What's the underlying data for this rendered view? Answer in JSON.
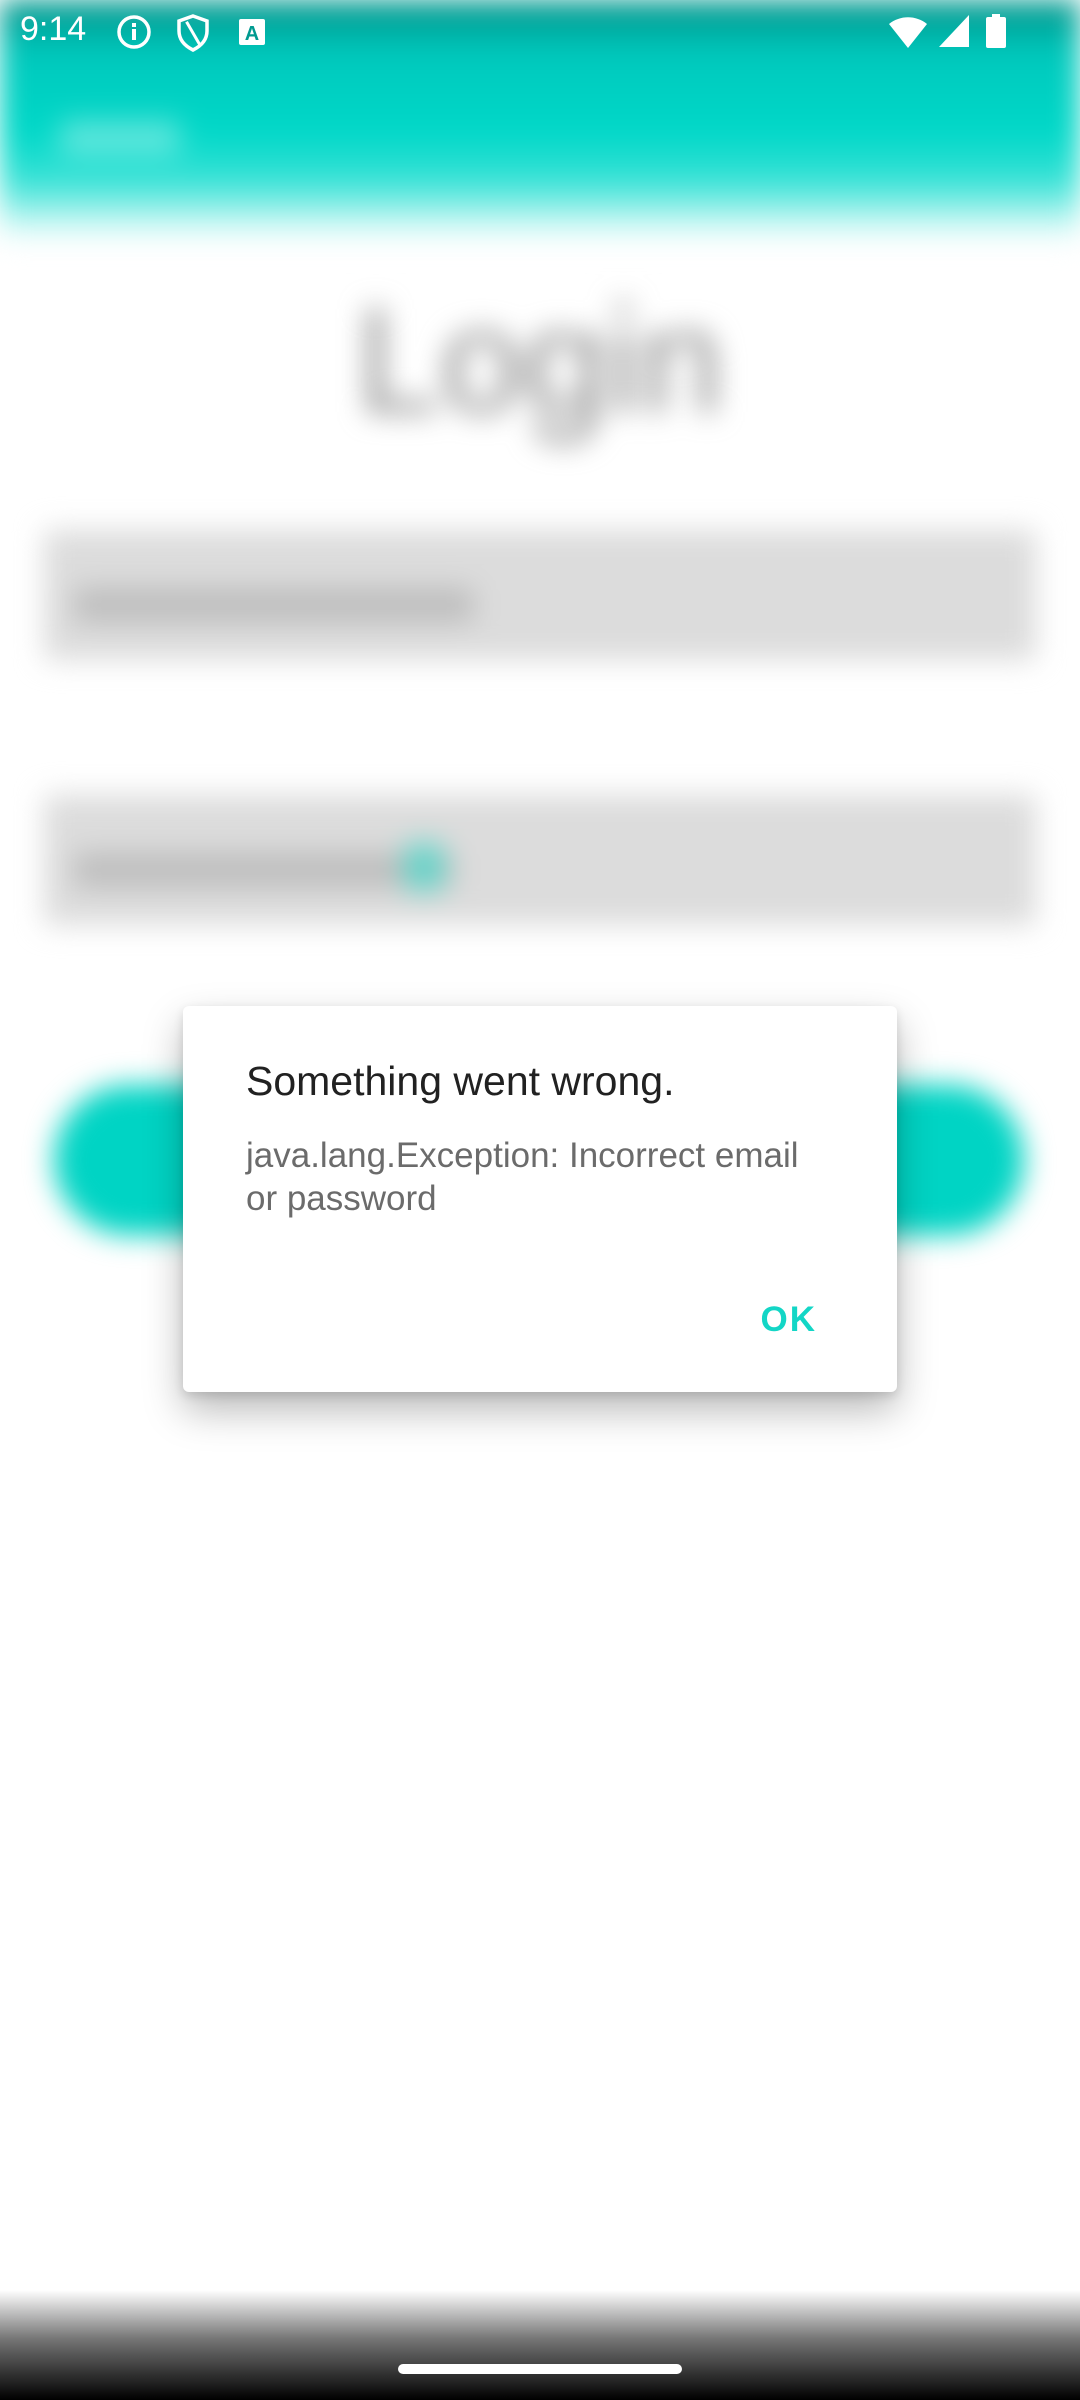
{
  "status_bar": {
    "time": "9:14",
    "left_icons": [
      "info-icon",
      "shield-icon",
      "a-badge-icon"
    ],
    "right_icons": [
      "wifi-icon",
      "signal-icon",
      "battery-icon"
    ],
    "a_badge_letter": "A"
  },
  "background_screen": {
    "title": "Login",
    "accent_color": "#00d4c4"
  },
  "dialog": {
    "title": "Something went wrong.",
    "message": "java.lang.Exception: Incorrect email or password",
    "ok_label": "OK",
    "ok_color": "#13d6c6"
  }
}
